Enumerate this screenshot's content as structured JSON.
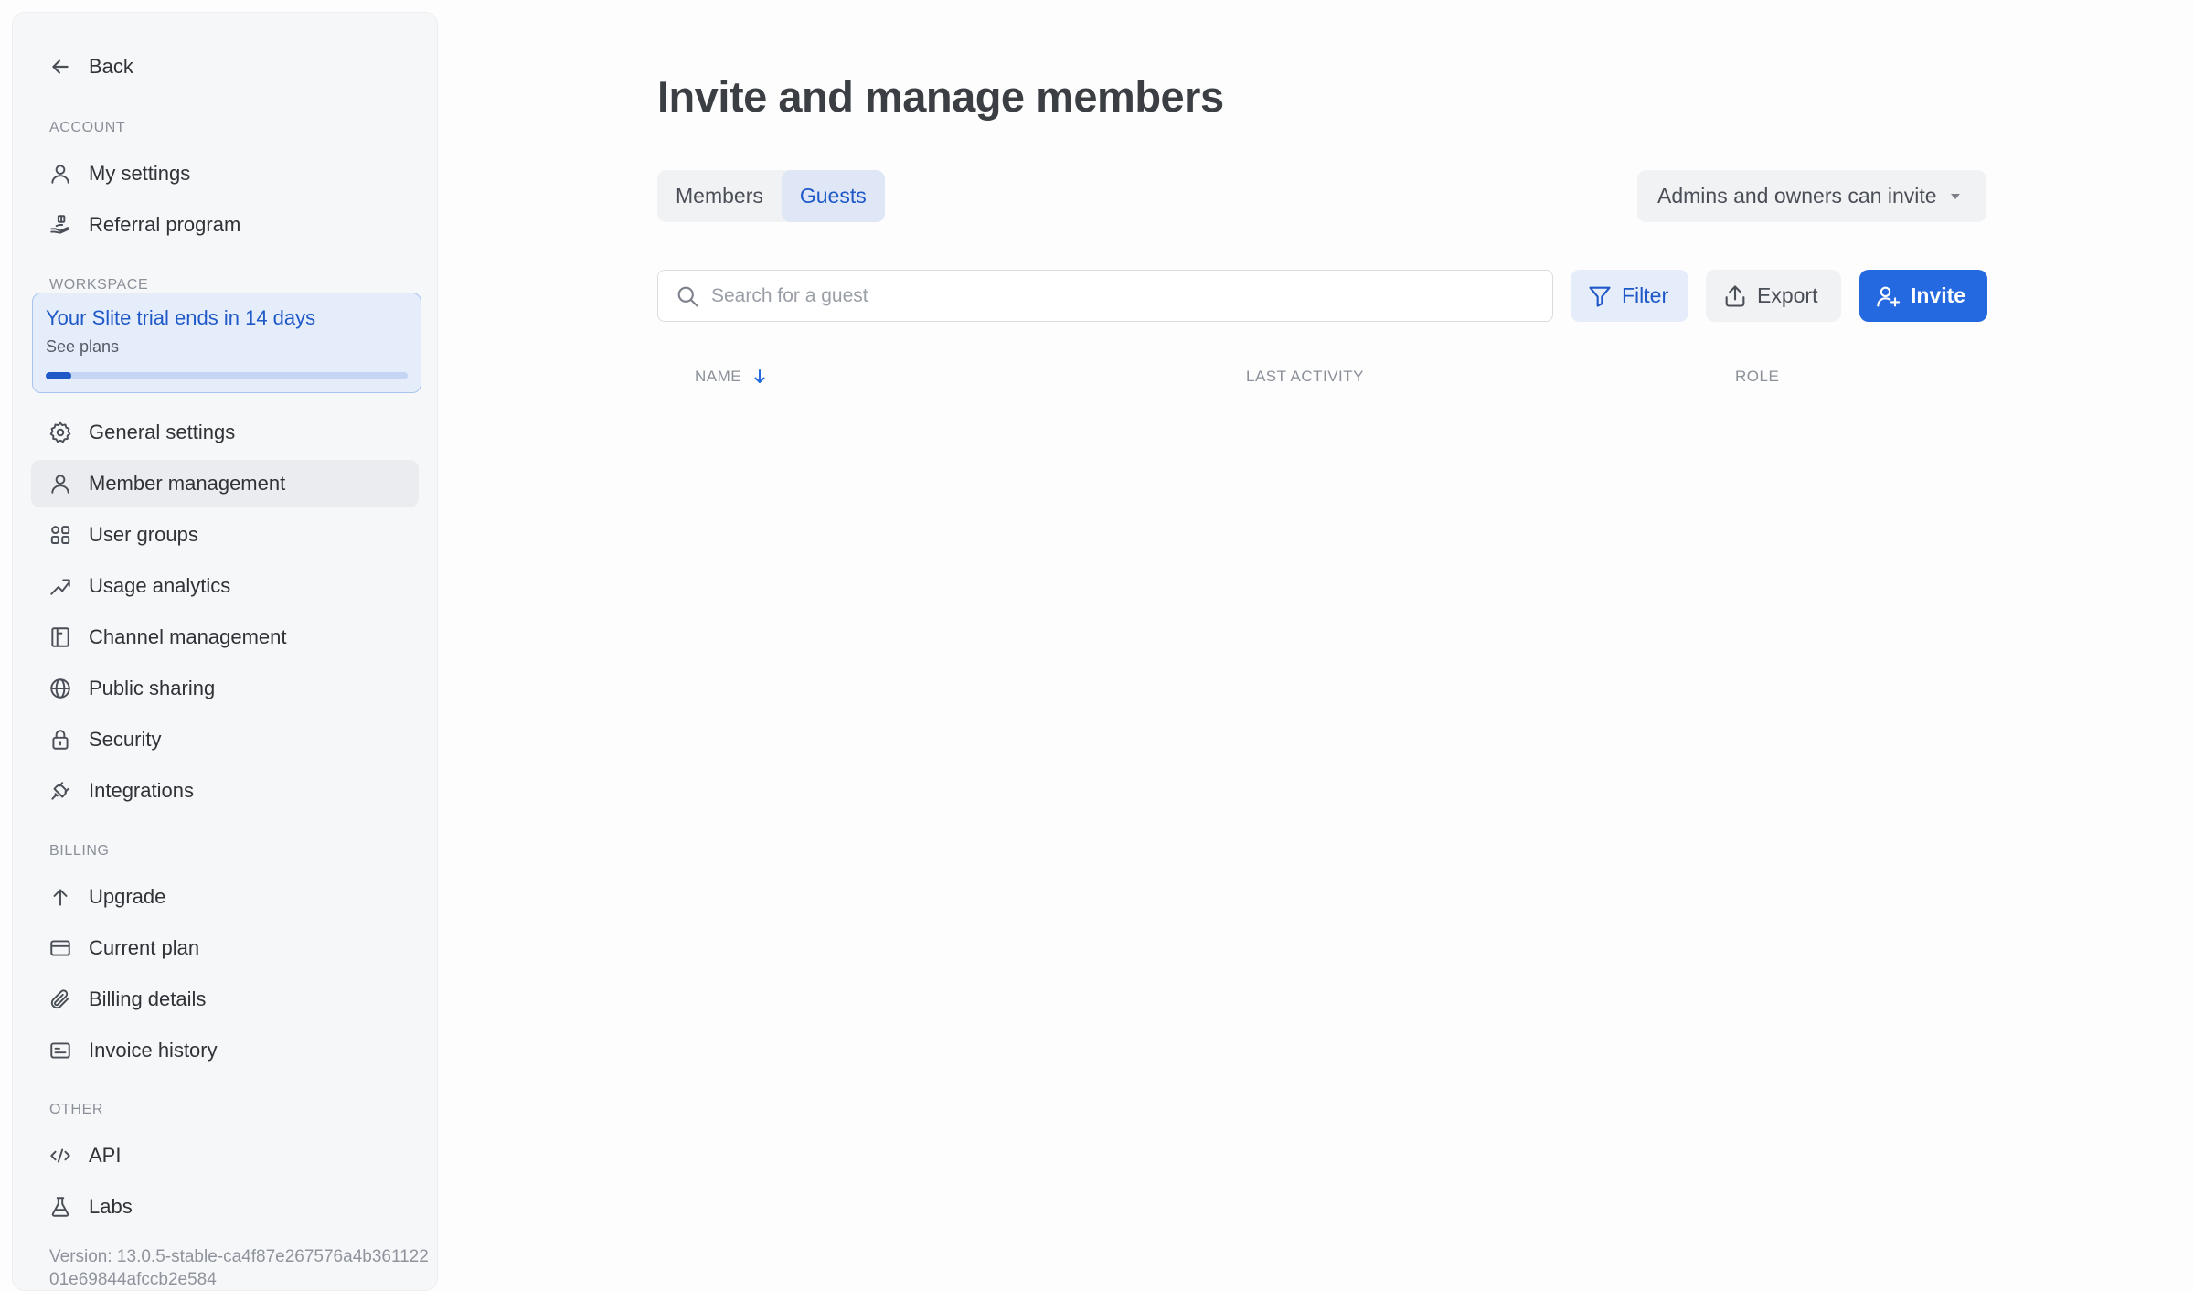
{
  "sidebar": {
    "back_label": "Back",
    "sections": {
      "account": "Account",
      "workspace": "Workspace",
      "billing": "Billing",
      "other": "Other"
    },
    "account_items": [
      {
        "label": "My settings",
        "icon": "user-icon"
      },
      {
        "label": "Referral program",
        "icon": "gift-hand-icon"
      }
    ],
    "trial": {
      "title": "Your Slite trial ends in 14 days",
      "subtitle": "See plans",
      "progress_percent": 7
    },
    "workspace_items": [
      {
        "label": "General settings",
        "icon": "gear-icon"
      },
      {
        "label": "Member management",
        "icon": "user-icon",
        "active": true
      },
      {
        "label": "User groups",
        "icon": "user-groups-icon"
      },
      {
        "label": "Usage analytics",
        "icon": "trend-up-icon"
      },
      {
        "label": "Channel management",
        "icon": "layout-icon"
      },
      {
        "label": "Public sharing",
        "icon": "globe-icon"
      },
      {
        "label": "Security",
        "icon": "lock-icon"
      },
      {
        "label": "Integrations",
        "icon": "plug-icon"
      }
    ],
    "billing_items": [
      {
        "label": "Upgrade",
        "icon": "arrow-up-icon"
      },
      {
        "label": "Current plan",
        "icon": "credit-card-icon"
      },
      {
        "label": "Billing details",
        "icon": "paperclip-icon"
      },
      {
        "label": "Invoice history",
        "icon": "invoice-icon"
      }
    ],
    "other_items": [
      {
        "label": "API",
        "icon": "code-icon"
      },
      {
        "label": "Labs",
        "icon": "flask-icon"
      }
    ],
    "version": "Version: 13.0.5-stable-ca4f87e267576a4b36112201e69844afccb2e584"
  },
  "main": {
    "title": "Invite and manage members",
    "tabs": [
      {
        "label": "Members",
        "active": false
      },
      {
        "label": "Guests",
        "active": true
      }
    ],
    "invite_policy": "Admins and owners can invite",
    "search": {
      "placeholder": "Search for a guest",
      "value": ""
    },
    "buttons": {
      "filter": "Filter",
      "export": "Export",
      "invite": "Invite"
    },
    "table": {
      "columns": [
        "Name",
        "Last activity",
        "Role"
      ],
      "sort_column": "Name",
      "sort_direction": "descending",
      "rows": []
    }
  },
  "colors": {
    "accent": "#2569e0",
    "accent_text": "#1f58c7",
    "sidebar_bg": "#f6f7f9",
    "trial_bg": "#e5edfb"
  }
}
